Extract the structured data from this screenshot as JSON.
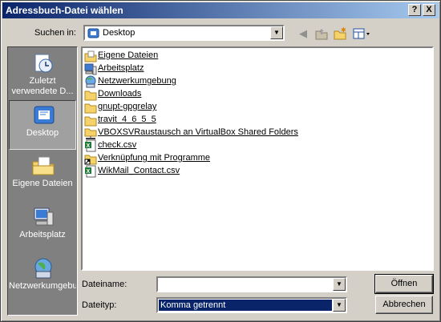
{
  "window": {
    "title": "Adressbuch-Datei wählen",
    "help_label": "?",
    "close_label": "X"
  },
  "lookin": {
    "label": "Suchen in:",
    "value": "Desktop"
  },
  "toolbar": {
    "icons": [
      "back-icon",
      "up-folder-icon",
      "new-folder-icon",
      "view-menu-icon"
    ]
  },
  "places": [
    {
      "label": "Zuletzt verwendete D...",
      "icon": "recent-documents-icon"
    },
    {
      "label": "Desktop",
      "icon": "desktop-icon",
      "selected": true
    },
    {
      "label": "Eigene Dateien",
      "icon": "my-documents-icon"
    },
    {
      "label": "Arbeitsplatz",
      "icon": "my-computer-icon"
    },
    {
      "label": "Netzwerkumgebung",
      "icon": "network-places-icon"
    }
  ],
  "files": [
    {
      "name": "Eigene Dateien",
      "icon": "my-documents-icon"
    },
    {
      "name": "Arbeitsplatz",
      "icon": "my-computer-icon"
    },
    {
      "name": "Netzwerkumgebung",
      "icon": "network-places-icon"
    },
    {
      "name": "Downloads",
      "icon": "folder-icon"
    },
    {
      "name": "gnupt-gpgrelay",
      "icon": "folder-icon"
    },
    {
      "name": "travit_4_6_5_5",
      "icon": "folder-icon"
    },
    {
      "name": "VBOXSVRaustausch an VirtualBox Shared Folders",
      "icon": "shared-folder-icon"
    },
    {
      "name": "check.csv",
      "icon": "excel-file-icon"
    },
    {
      "name": "Verknüpfung mit Programme",
      "icon": "shortcut-folder-icon"
    },
    {
      "name": "WikMail_Contact.csv",
      "icon": "excel-file-icon"
    }
  ],
  "filename": {
    "label": "Dateiname:",
    "value": ""
  },
  "filetype": {
    "label": "Dateityp:",
    "value": "Komma getrennt"
  },
  "buttons": {
    "open": "Öffnen",
    "cancel": "Abbrechen"
  },
  "colors": {
    "title_start": "#0a246a",
    "title_end": "#a6caf0",
    "selection": "#0a246a",
    "face": "#d4d0c8"
  }
}
